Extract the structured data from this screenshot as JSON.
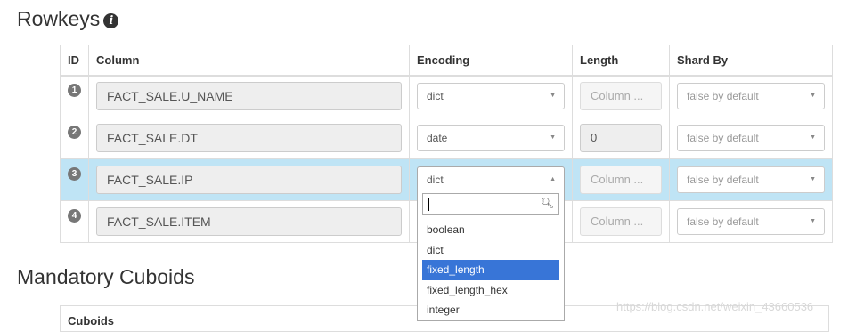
{
  "rowkeys": {
    "title": "Rowkeys",
    "info_icon": "info-circle-icon",
    "headers": {
      "id": "ID",
      "column": "Column",
      "encoding": "Encoding",
      "length": "Length",
      "shard_by": "Shard By"
    },
    "rows": [
      {
        "id": "1",
        "column": "FACT_SALE.U_NAME",
        "encoding": "dict",
        "length": "Column ...",
        "shard_by": "false by default"
      },
      {
        "id": "2",
        "column": "FACT_SALE.DT",
        "encoding": "date",
        "length": "0",
        "shard_by": "false by default"
      },
      {
        "id": "3",
        "column": "FACT_SALE.IP",
        "encoding": "dict",
        "length": "Column ...",
        "shard_by": "false by default"
      },
      {
        "id": "4",
        "column": "FACT_SALE.ITEM",
        "encoding": "",
        "length": "Column ...",
        "shard_by": "false by default"
      }
    ],
    "selected_row": 3
  },
  "encoding_dropdown": {
    "search_value": "",
    "options": [
      "boolean",
      "dict",
      "fixed_length",
      "fixed_length_hex",
      "integer"
    ],
    "highlighted": "fixed_length"
  },
  "mandatory_cuboids": {
    "title": "Mandatory Cuboids",
    "header": "Cuboids"
  },
  "watermark": "https://blog.csdn.net/weixin_43660536",
  "colors": {
    "selected_row": "#bfe4f5",
    "highlight": "#3875d7",
    "badge": "#777777"
  }
}
